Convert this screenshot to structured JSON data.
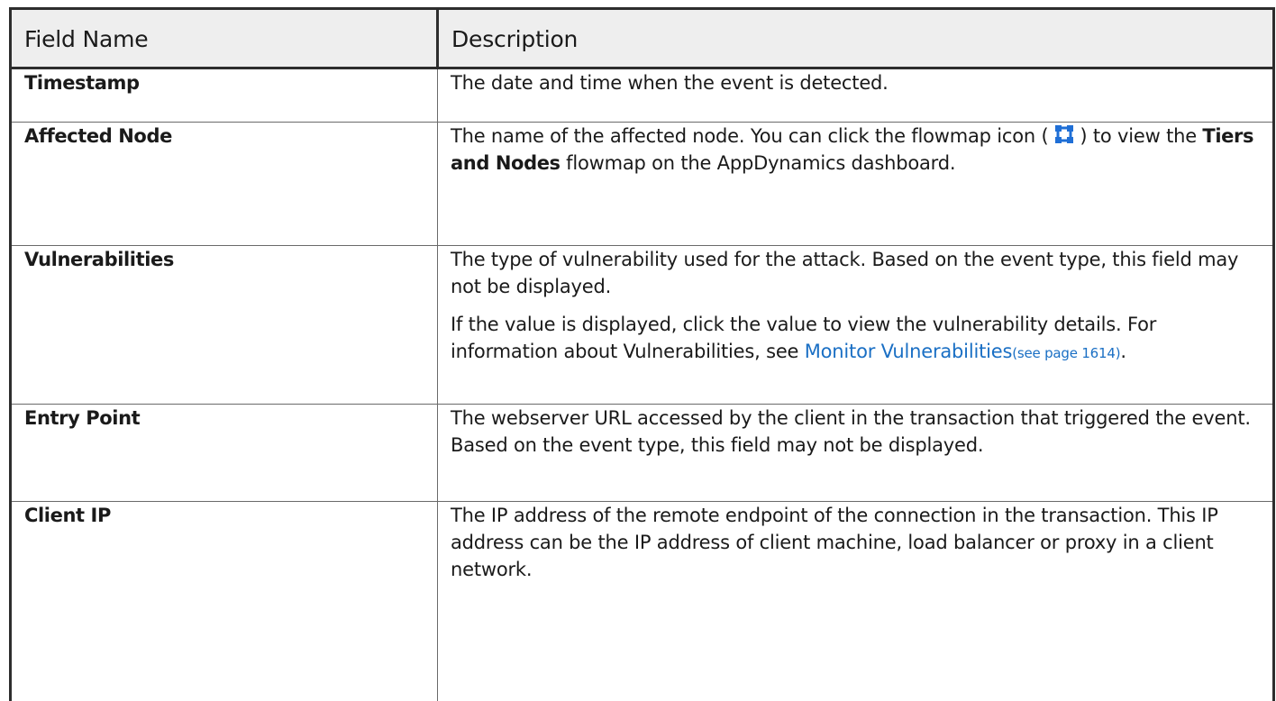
{
  "table": {
    "headers": {
      "field_name": "Field Name",
      "description": "Description"
    },
    "rows": {
      "timestamp": {
        "field": "Timestamp",
        "desc": "The date and time when the event is detected."
      },
      "affected_node": {
        "field": "Affected Node",
        "desc_before_icon": "The name of the affected node. You can click the flowmap icon ( ",
        "desc_after_icon": " ) to view the ",
        "desc_bold": "Tiers and Nodes",
        "desc_end": " flowmap on the AppDynamics dashboard.",
        "icon": "flowmap-icon"
      },
      "vulnerabilities": {
        "field": "Vulnerabilities",
        "para1": "The type of vulnerability used for the attack. Based on the event type, this field may not be displayed.",
        "para2_text": "If the value is displayed, click the value to view the vulnerability details. For information about Vulnerabilities, see ",
        "link_text": "Monitor Vulnerabilities",
        "link_page": "(see page 1614)",
        "para2_end": "."
      },
      "entry_point": {
        "field": "Entry Point",
        "desc": "The webserver URL accessed by the client in the transaction that triggered the event. Based on the event type, this field may not be displayed."
      },
      "client_ip": {
        "field": "Client IP",
        "desc": "The IP address of the remote endpoint of the connection in the transaction. This IP address can be the IP address of client machine, load balancer or proxy in a client network."
      }
    }
  },
  "colors": {
    "link": "#1a6fc4",
    "header_bg": "#eeeeee",
    "icon": "#1f6fd6"
  }
}
